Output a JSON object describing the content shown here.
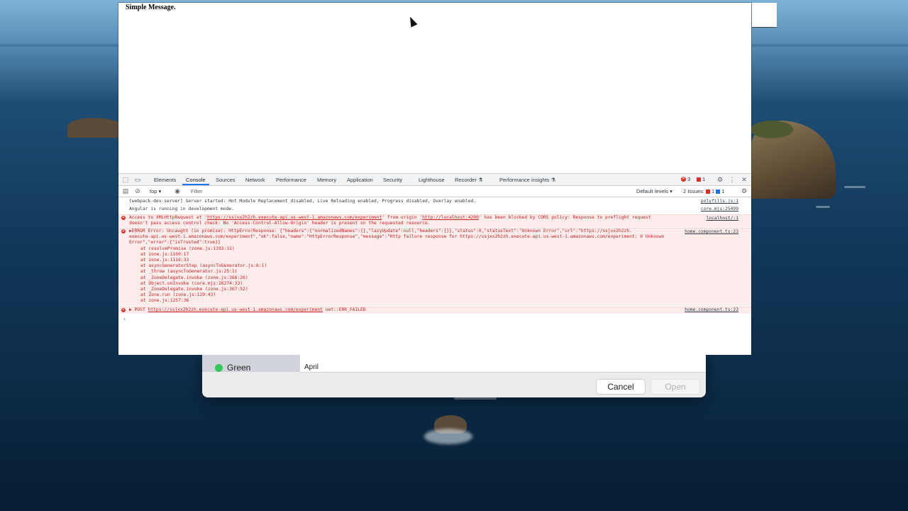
{
  "page": {
    "message": "Simple Message."
  },
  "devtools": {
    "tabs": [
      "Elements",
      "Console",
      "Sources",
      "Network",
      "Performance",
      "Memory",
      "Application",
      "Security",
      "Lighthouse",
      "Recorder ⚗",
      "Performance insights ⚗"
    ],
    "error_count": "3",
    "warning_count": "1",
    "context": "top",
    "filter_placeholder": "Filter",
    "levels": "Default levels ▾",
    "issues_label": "2 Issues:",
    "issues_red": "1",
    "issues_blue": "1"
  },
  "console": {
    "messages": [
      {
        "text": "[webpack-dev-server] Server started: Hot Module Replacement disabled, Live Reloading enabled, Progress disabled, Overlay enabled.",
        "source": "polyfills.js:1"
      },
      {
        "text": "Angular is running in development mode.",
        "source": "core.mjs:25499"
      },
      {
        "line1a": "Access to XMLHttpRequest at '",
        "line1_link1": "https://ssjxx2h2zh.execute-api.us-west-1.amazonaws.com/experiment",
        "line1b": "' from origin '",
        "line1_link2": "http://localhost:4200",
        "line1c": "' has been blocked by CORS policy: Response to preflight request",
        "line2": "doesn't pass access control check: No 'Access-Control-Allow-Origin' header is present on the requested resource.",
        "source": "localhost/:1"
      },
      {
        "line1": "ERROR Error: Uncaught (in promise): HttpErrorResponse: {\"headers\":{\"normalizedNames\":{},\"lazyUpdate\":null,\"headers\":{}},\"status\":0,\"statusText\":\"Unknown Error\",\"url\":\"https://ssjxx2h2zh.",
        "line2": "execute-api.us-west-1.amazonaws.com/experiment\",\"ok\":false,\"name\":\"HttpErrorResponse\",\"message\":\"Http failure response for https://ssjxx2h2zh.execute-api.us-west-1.amazonaws.com/experiment: 0 Unknown",
        "line3": "Error\",\"error\":{\"isTrusted\":true}}",
        "stack": [
          "at resolvePromise (zone.js:1193:31)",
          "at zone.js:1100:17",
          "at zone.js:1116:33",
          "at asyncGeneratorStep (asyncToGenerator.js:6:1)",
          "at _throw (asyncToGenerator.js:25:1)",
          "at _ZoneDelegate.invoke (zone.js:368:26)",
          "at Object.onInvoke (core.mjs:26274:33)",
          "at _ZoneDelegate.invoke (zone.js:367:52)",
          "at Zone.run (zone.js:129:43)",
          "at zone.js:1257:36"
        ],
        "source": "home.component.ts:23"
      },
      {
        "method": "▶ POST",
        "url": "https://ssjxx2h2zh.execute-api.us-west-1.amazonaws.com/experiment",
        "status": "net::ERR_FAILED",
        "source": "home.component.ts:23"
      }
    ],
    "prompt": "›"
  },
  "file_dialog": {
    "tag_label": "Green",
    "row_text": "April",
    "cancel_label": "Cancel",
    "open_label": "Open"
  }
}
